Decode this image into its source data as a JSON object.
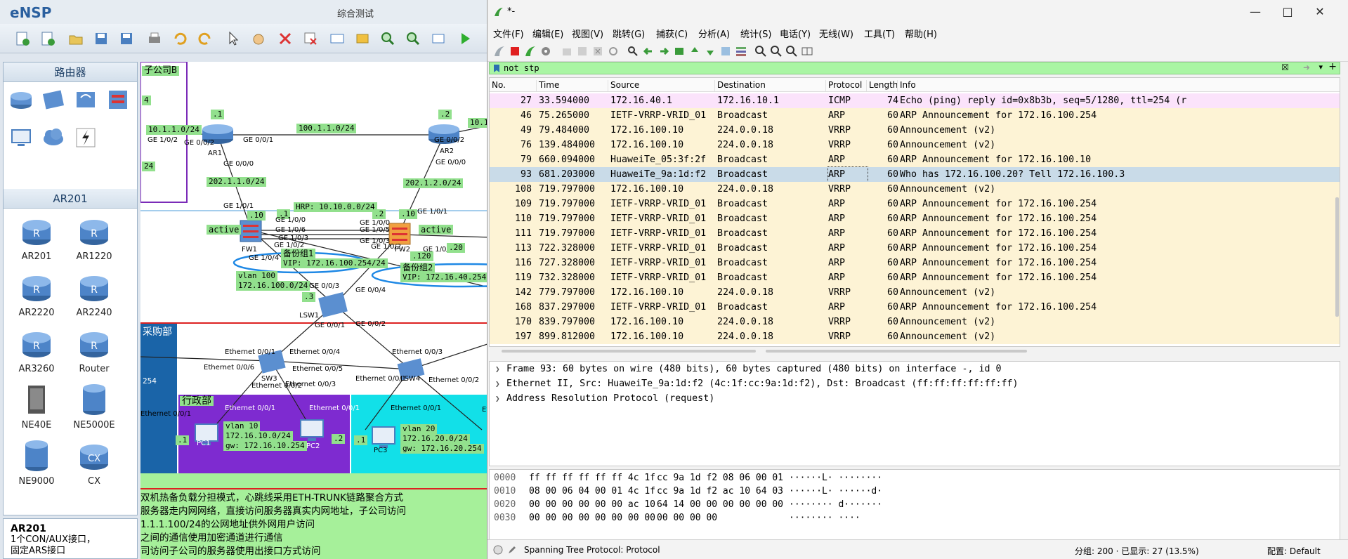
{
  "ensp": {
    "logo": "eNSP",
    "window_title": "综合测试",
    "palette": {
      "section1_title": "路由器",
      "section2_title": "AR201",
      "devices": [
        "AR201",
        "AR1220",
        "AR2220",
        "AR2240",
        "AR3260",
        "Router",
        "NE40E",
        "NE5000E",
        "NE9000",
        "CX"
      ],
      "info_title": "AR201",
      "info_line1": "1个CON/AUX接口，",
      "info_line2": "固定ARS接口"
    },
    "canvas": {
      "labels": [
        "子公司B",
        "4",
        "10.1.1.0/24",
        "GE 1/0/2",
        "GE 0/0/2",
        "AR1",
        ".1",
        "GE 0/0/1",
        "100.1.1.0/24",
        ".2",
        "GE 0/0/2",
        "AR2",
        "10.1",
        "GE 0/0/0",
        "GE 0/0/0",
        "24",
        "202.1.1.0/24",
        "202.1.2.0/24",
        "GE 1/0/1",
        "HRP: 10.10.0.0/24",
        ".1",
        ".2",
        ".10",
        ".10",
        "GE 1/0/1",
        "active",
        "GE 1/0/0",
        "GE 1/0/0",
        "GE 1/0/6",
        "GE 1/0/5",
        "GE 1/0/3",
        "GE 1/0/3",
        "GE 1/0/2",
        "GE 1/0/2",
        "GE 1/0/4",
        "active",
        "FW1",
        "FW2",
        "GE 1/0/3",
        ".20",
        "备份组1",
        "VIP: 172.16.100.254/24",
        "备份组2",
        "VIP: 172.16.40.254",
        ".120",
        "vlan 100",
        "172.16.100.0/24",
        "GE 0/0/3",
        "GE 0/0/4",
        ".3",
        "LSW1",
        "GE 0/0/1",
        "GE 0/0/2",
        "采购部",
        "Ethernet 0/0/1",
        "Ethernet 0/0/4",
        "Ethernet 0/0/3",
        "Ethernet 0/0/6",
        "Ethernet 0/0/5",
        "SW3",
        "Ethernet 0/0/1",
        "LSW4",
        "Ethernet 0/0/2",
        "Ethernet 0/0/2",
        "Ethernet 0/0/3",
        "254",
        "行政部",
        "Ethernet 0/0/1",
        "Ethernet 0/0/1",
        "Ethernet 0/0/1",
        "Ethernet 0/0/1",
        "Ethe",
        "vlan 10",
        "172.16.10.0/24",
        "gw: 172.16.10.254",
        ".1",
        "PC1",
        ".2",
        "PC2",
        "PC3",
        ".1",
        "vlan 20",
        "172.16.20.0/24",
        "gw: 172.16.20.254"
      ],
      "notes": [
        "双机热备负载分担模式，心跳线采用ETH-TRUNK链路聚合方式",
        "服务器走内网网络，直接访问服务器真实内网地址，子公司访问",
        "1.1.1.100/24的公网地址供外网用户访问",
        "之间的通信使用加密通道进行通信",
        "司访问子公司的服务器使用出接口方式访问"
      ]
    }
  },
  "wireshark": {
    "title": "*-",
    "menu": [
      "文件(F)",
      "编辑(E)",
      "视图(V)",
      "跳转(G)",
      "捕获(C)",
      "分析(A)",
      "统计(S)",
      "电话(Y)",
      "无线(W)",
      "工具(T)",
      "帮助(H)"
    ],
    "filter": "not stp",
    "columns": [
      "No.",
      "Time",
      "Source",
      "Destination",
      "Protocol",
      "Length",
      "Info"
    ],
    "packets": [
      {
        "no": "27",
        "time": "33.594000",
        "src": "172.16.40.1",
        "dst": "172.16.10.1",
        "proto": "ICMP",
        "len": "74",
        "info": "Echo (ping) reply    id=0x8b3b, seq=5/1280, ttl=254 (r",
        "bg": "#fbe3fb"
      },
      {
        "no": "46",
        "time": "75.265000",
        "src": "IETF-VRRP-VRID_01",
        "dst": "Broadcast",
        "proto": "ARP",
        "len": "60",
        "info": "ARP Announcement for 172.16.100.254",
        "bg": "#fdf3d5"
      },
      {
        "no": "49",
        "time": "79.484000",
        "src": "172.16.100.10",
        "dst": "224.0.0.18",
        "proto": "VRRP",
        "len": "60",
        "info": "Announcement (v2)",
        "bg": "#fdf3d5"
      },
      {
        "no": "76",
        "time": "139.484000",
        "src": "172.16.100.10",
        "dst": "224.0.0.18",
        "proto": "VRRP",
        "len": "60",
        "info": "Announcement (v2)",
        "bg": "#fdf3d5"
      },
      {
        "no": "79",
        "time": "660.094000",
        "src": "HuaweiTe_05:3f:2f",
        "dst": "Broadcast",
        "proto": "ARP",
        "len": "60",
        "info": "ARP Announcement for 172.16.100.10",
        "bg": "#fdf3d5"
      },
      {
        "no": "93",
        "time": "681.203000",
        "src": "HuaweiTe_9a:1d:f2",
        "dst": "Broadcast",
        "proto": "ARP",
        "len": "60",
        "info": "Who has 172.16.100.20? Tell 172.16.100.3",
        "bg": "#c9dbe8"
      },
      {
        "no": "108",
        "time": "719.797000",
        "src": "172.16.100.10",
        "dst": "224.0.0.18",
        "proto": "VRRP",
        "len": "60",
        "info": "Announcement (v2)",
        "bg": "#fdf3d5"
      },
      {
        "no": "109",
        "time": "719.797000",
        "src": "IETF-VRRP-VRID_01",
        "dst": "Broadcast",
        "proto": "ARP",
        "len": "60",
        "info": "ARP Announcement for 172.16.100.254",
        "bg": "#fdf3d5"
      },
      {
        "no": "110",
        "time": "719.797000",
        "src": "IETF-VRRP-VRID_01",
        "dst": "Broadcast",
        "proto": "ARP",
        "len": "60",
        "info": "ARP Announcement for 172.16.100.254",
        "bg": "#fdf3d5"
      },
      {
        "no": "111",
        "time": "719.797000",
        "src": "IETF-VRRP-VRID_01",
        "dst": "Broadcast",
        "proto": "ARP",
        "len": "60",
        "info": "ARP Announcement for 172.16.100.254",
        "bg": "#fdf3d5"
      },
      {
        "no": "113",
        "time": "722.328000",
        "src": "IETF-VRRP-VRID_01",
        "dst": "Broadcast",
        "proto": "ARP",
        "len": "60",
        "info": "ARP Announcement for 172.16.100.254",
        "bg": "#fdf3d5"
      },
      {
        "no": "116",
        "time": "727.328000",
        "src": "IETF-VRRP-VRID_01",
        "dst": "Broadcast",
        "proto": "ARP",
        "len": "60",
        "info": "ARP Announcement for 172.16.100.254",
        "bg": "#fdf3d5"
      },
      {
        "no": "119",
        "time": "732.328000",
        "src": "IETF-VRRP-VRID_01",
        "dst": "Broadcast",
        "proto": "ARP",
        "len": "60",
        "info": "ARP Announcement for 172.16.100.254",
        "bg": "#fdf3d5"
      },
      {
        "no": "142",
        "time": "779.797000",
        "src": "172.16.100.10",
        "dst": "224.0.0.18",
        "proto": "VRRP",
        "len": "60",
        "info": "Announcement (v2)",
        "bg": "#fdf3d5"
      },
      {
        "no": "168",
        "time": "837.297000",
        "src": "IETF-VRRP-VRID_01",
        "dst": "Broadcast",
        "proto": "ARP",
        "len": "60",
        "info": "ARP Announcement for 172.16.100.254",
        "bg": "#fdf3d5"
      },
      {
        "no": "170",
        "time": "839.797000",
        "src": "172.16.100.10",
        "dst": "224.0.0.18",
        "proto": "VRRP",
        "len": "60",
        "info": "Announcement (v2)",
        "bg": "#fdf3d5"
      },
      {
        "no": "197",
        "time": "899.812000",
        "src": "172.16.100.10",
        "dst": "224.0.0.18",
        "proto": "VRRP",
        "len": "60",
        "info": "Announcement (v2)",
        "bg": "#fdf3d5"
      }
    ],
    "details": [
      "Frame 93: 60 bytes on wire (480 bits), 60 bytes captured (480 bits) on interface -, id 0",
      "Ethernet II, Src: HuaweiTe_9a:1d:f2 (4c:1f:cc:9a:1d:f2), Dst: Broadcast (ff:ff:ff:ff:ff:ff)",
      "Address Resolution Protocol (request)"
    ],
    "bytes": [
      {
        "off": "0000",
        "hex1": "ff ff ff ff ff ff 4c 1f",
        "hex2": "cc 9a 1d f2 08 06 00 01",
        "ascii": "······L· ········"
      },
      {
        "off": "0010",
        "hex1": "08 00 06 04 00 01 4c 1f",
        "hex2": "cc 9a 1d f2 ac 10 64 03",
        "ascii": "······L· ······d·"
      },
      {
        "off": "0020",
        "hex1": "00 00 00 00 00 00 ac 10",
        "hex2": "64 14 00 00 00 00 00 00",
        "ascii": "········ d·······"
      },
      {
        "off": "0030",
        "hex1": "00 00 00 00 00 00 00 00",
        "hex2": "00 00 00 00",
        "ascii": "········ ····"
      }
    ],
    "status": {
      "protocol": "Spanning Tree Protocol: Protocol",
      "counts": "分组: 200 · 已显示: 27 (13.5%)",
      "profile": "配置: Default"
    },
    "colors": {
      "filter_ok": "#a9f5a3",
      "selected_row": "#c9dbe8",
      "icmp_row": "#fbe3fb",
      "arp_row": "#fdf3d5"
    }
  }
}
